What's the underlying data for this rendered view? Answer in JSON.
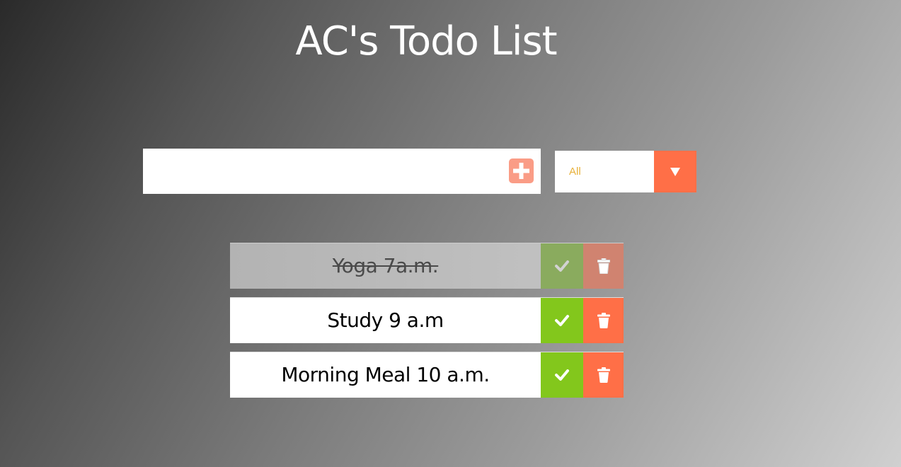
{
  "header": {
    "title": "AC's Todo List"
  },
  "form": {
    "input_value": "",
    "add_icon": "plus-square-icon",
    "filter": {
      "selected": "All",
      "arrow_icon": "caret-down-icon"
    }
  },
  "todos": [
    {
      "text": "Yoga 7a.m.",
      "completed": true
    },
    {
      "text": "Study 9 a.m",
      "completed": false
    },
    {
      "text": "Morning Meal 10 a.m.",
      "completed": false
    }
  ],
  "icons": {
    "check": "check-icon",
    "trash": "trash-icon"
  },
  "colors": {
    "accent": "#ff6f47",
    "add_button": "#fa9c86",
    "check_button": "#83c71c",
    "filter_text": "#e8b13a"
  }
}
